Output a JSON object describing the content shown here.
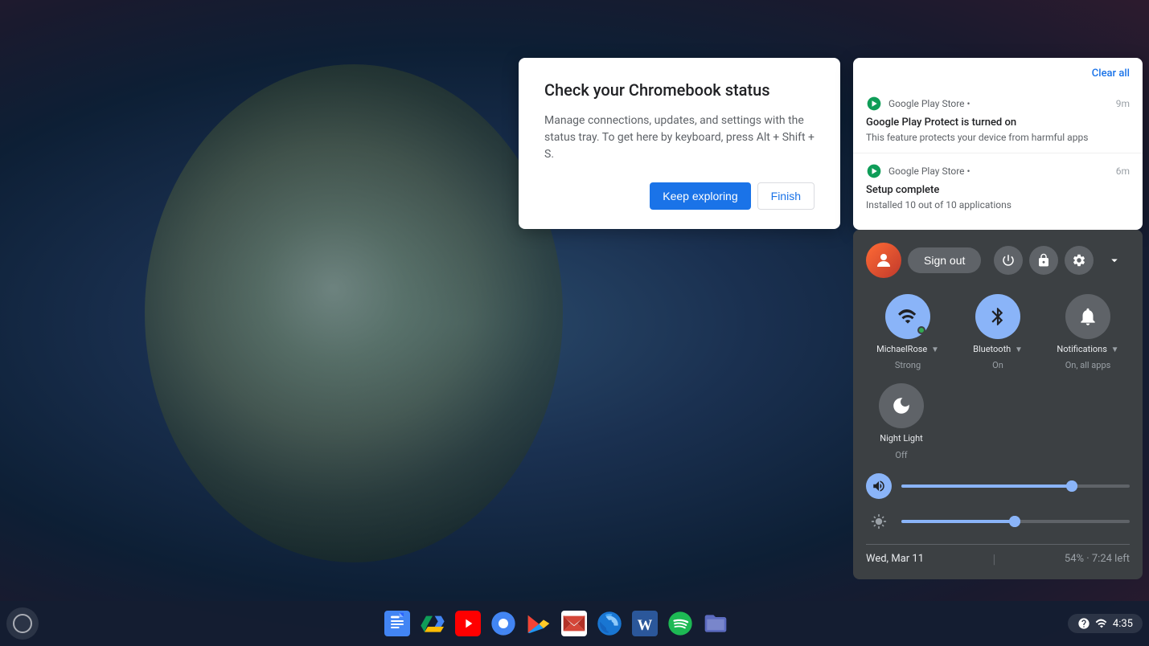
{
  "desktop": {
    "background": "dark blue gradient"
  },
  "chromebook_card": {
    "title": "Check your Chromebook status",
    "body": "Manage connections, updates, and settings with the status tray. To get here by keyboard, press Alt + Shift + S.",
    "btn_keep_exploring": "Keep exploring",
    "btn_finish": "Finish"
  },
  "notification_panel": {
    "clear_all": "Clear all",
    "notifications": [
      {
        "app": "Google Play Store",
        "time": "9m",
        "title": "Google Play Protect is turned on",
        "body": "This feature protects your device from harmful apps"
      },
      {
        "app": "Google Play Store",
        "time": "6m",
        "title": "Setup complete",
        "body": "Installed 10 out of 10 applications"
      }
    ]
  },
  "system_tray": {
    "sign_out": "Sign out",
    "controls": [
      {
        "label": "MichaelRose",
        "sublabel": "Strong",
        "active": true
      },
      {
        "label": "Bluetooth",
        "sublabel": "On",
        "active": true
      },
      {
        "label": "Notifications",
        "sublabel": "On, all apps",
        "active": false
      }
    ],
    "night_light": {
      "label": "Night Light",
      "sublabel": "Off",
      "active": false
    },
    "volume_percent": 75,
    "brightness_percent": 50,
    "date": "Wed, Mar 11",
    "battery": "54% · 7:24 left"
  },
  "taskbar": {
    "time": "4:35",
    "apps": [
      {
        "name": "Google Docs",
        "id": "docs"
      },
      {
        "name": "Google Drive",
        "id": "drive"
      },
      {
        "name": "YouTube",
        "id": "youtube"
      },
      {
        "name": "Google Chrome",
        "id": "chrome"
      },
      {
        "name": "Google Play",
        "id": "play"
      },
      {
        "name": "Gmail",
        "id": "gmail"
      },
      {
        "name": "Google Earth",
        "id": "earth"
      },
      {
        "name": "Microsoft Word",
        "id": "word"
      },
      {
        "name": "Spotify",
        "id": "spotify"
      },
      {
        "name": "Files",
        "id": "files"
      }
    ]
  }
}
